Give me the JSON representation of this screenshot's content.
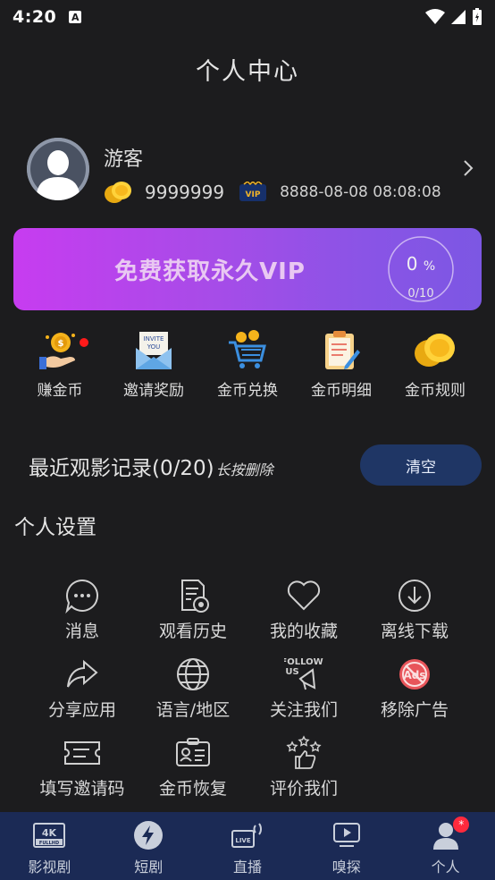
{
  "status_bar": {
    "time": "4:20",
    "notif_icon": "A"
  },
  "header": {
    "title": "个人中心"
  },
  "profile": {
    "name": "游客",
    "coins": "9999999",
    "vip_label": "VIP",
    "vip_expiry": "8888-08-08 08:08:08"
  },
  "vip_banner": {
    "text": "免费获取永久VIP",
    "percent": "0",
    "percent_sign": "%",
    "count": "0/10",
    "progress_fraction": 0
  },
  "quick_actions": [
    {
      "label": "赚金币",
      "icon": "earn-coins-icon"
    },
    {
      "label": "邀请奖励",
      "icon": "invite-icon"
    },
    {
      "label": "金币兑换",
      "icon": "coin-cart-icon"
    },
    {
      "label": "金币明细",
      "icon": "coin-detail-icon"
    },
    {
      "label": "金币规则",
      "icon": "coin-rules-icon"
    }
  ],
  "recent": {
    "title": "最近观影记录(0/20)",
    "hint": "长按删除",
    "clear_label": "清空"
  },
  "settings": {
    "title": "个人设置",
    "items": [
      {
        "label": "消息",
        "icon": "message-icon"
      },
      {
        "label": "观看历史",
        "icon": "history-icon"
      },
      {
        "label": "我的收藏",
        "icon": "heart-icon"
      },
      {
        "label": "离线下载",
        "icon": "download-icon"
      },
      {
        "label": "分享应用",
        "icon": "share-icon"
      },
      {
        "label": "语言/地区",
        "icon": "globe-icon"
      },
      {
        "label": "关注我们",
        "icon": "follow-us-icon"
      },
      {
        "label": "移除广告",
        "icon": "no-ads-icon"
      },
      {
        "label": "填写邀请码",
        "icon": "ticket-icon"
      },
      {
        "label": "金币恢复",
        "icon": "id-card-icon"
      },
      {
        "label": "评价我们",
        "icon": "rate-icon"
      }
    ]
  },
  "bottom_nav": {
    "items": [
      {
        "label": "影视剧",
        "icon": "4k-icon"
      },
      {
        "label": "短剧",
        "icon": "lightning-icon"
      },
      {
        "label": "直播",
        "icon": "live-icon"
      },
      {
        "label": "嗅探",
        "icon": "play-icon"
      },
      {
        "label": "个人",
        "icon": "person-icon",
        "badge": "*"
      }
    ]
  },
  "colors": {
    "background": "#1c1c1e",
    "banner_start": "#c73cf0",
    "banner_end": "#7c57e3",
    "clear_button": "#1f3665",
    "nav_background": "#1b2a55",
    "badge_red": "#ff2a3d"
  }
}
